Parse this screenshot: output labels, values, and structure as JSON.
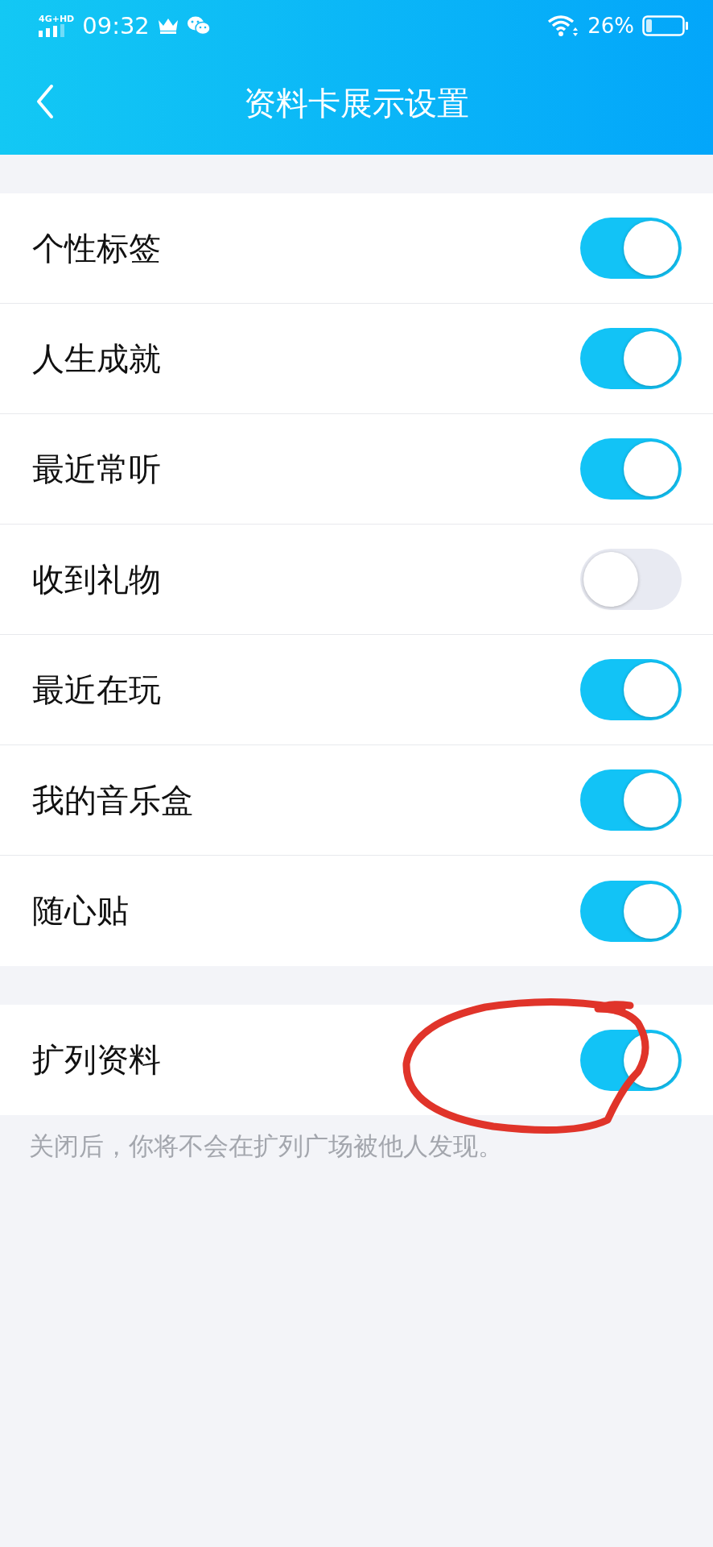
{
  "status_bar": {
    "network": "4G+HD",
    "time": "09:32",
    "battery": "26%"
  },
  "header": {
    "title": "资料卡展示设置"
  },
  "sections": [
    {
      "items": [
        {
          "label": "个性标签",
          "on": true
        },
        {
          "label": "人生成就",
          "on": true
        },
        {
          "label": "最近常听",
          "on": true
        },
        {
          "label": "收到礼物",
          "on": false
        },
        {
          "label": "最近在玩",
          "on": true
        },
        {
          "label": "我的音乐盒",
          "on": true
        },
        {
          "label": "随心贴",
          "on": true
        }
      ]
    },
    {
      "items": [
        {
          "label": "扩列资料",
          "on": true,
          "annotated": true
        }
      ],
      "hint": "关闭后，你将不会在扩列广场被他人发现。"
    }
  ]
}
